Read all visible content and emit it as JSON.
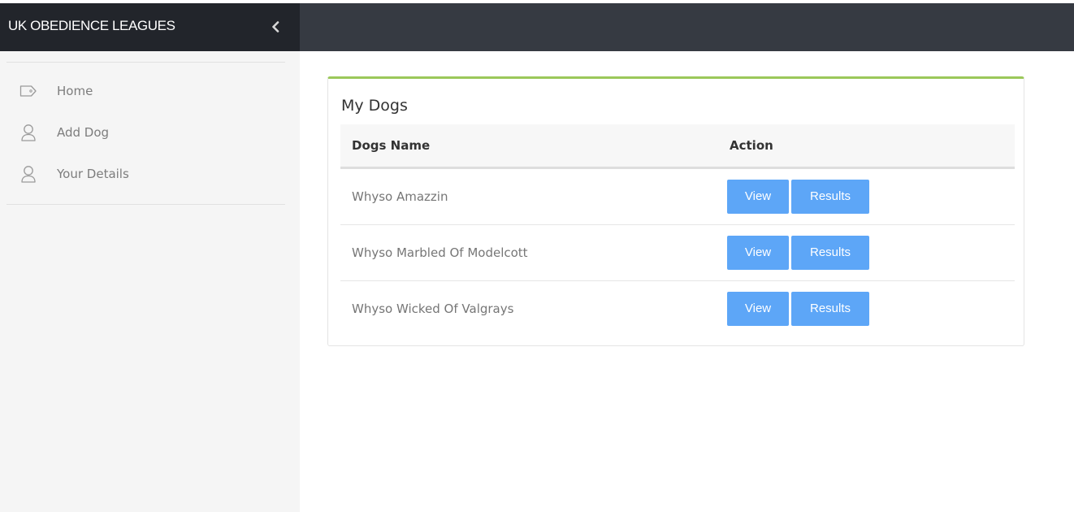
{
  "app": {
    "title": "UK OBEDIENCE LEAGUES"
  },
  "sidebar": {
    "items": [
      {
        "label": "Home",
        "icon": "tag-icon"
      },
      {
        "label": "Add Dog",
        "icon": "user-icon"
      },
      {
        "label": "Your Details",
        "icon": "user-icon"
      }
    ]
  },
  "panel": {
    "title": "My Dogs",
    "columns": {
      "name": "Dogs Name",
      "action": "Action"
    },
    "rows": [
      {
        "name": "Whyso Amazzin",
        "view_label": "View",
        "results_label": "Results"
      },
      {
        "name": "Whyso Marbled Of Modelcott",
        "view_label": "View",
        "results_label": "Results"
      },
      {
        "name": "Whyso Wicked Of Valgrays",
        "view_label": "View",
        "results_label": "Results"
      }
    ]
  },
  "colors": {
    "brand_bar": "#22252b",
    "topbar": "#363a42",
    "panel_accent": "#9bc85a",
    "button": "#5da6f7"
  }
}
